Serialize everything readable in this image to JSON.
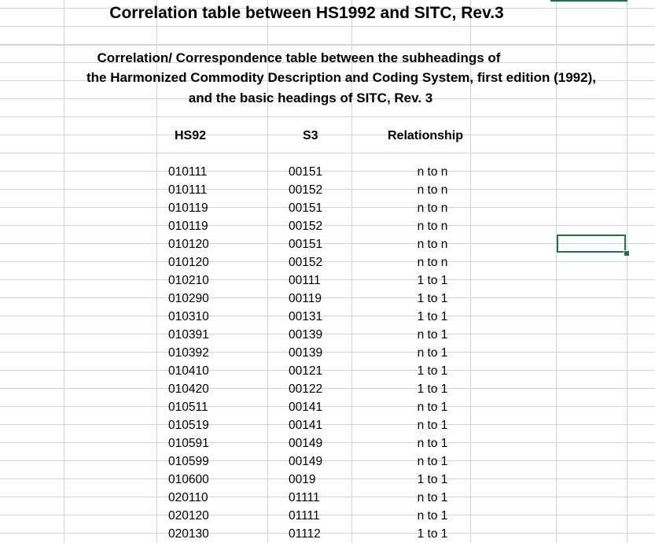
{
  "title": "Correlation table between HS1992 and SITC, Rev.3",
  "subtitle": {
    "line1": "Correlation/ Correspondence table between the subheadings of",
    "line2": "the Harmonized Commodity Description and Coding System, first edition (1992),",
    "line3": "and the basic headings of SITC, Rev. 3"
  },
  "headers": {
    "hs": "HS92",
    "s3": "S3",
    "rel": "Relationship"
  },
  "rows": [
    {
      "hs": "010111",
      "s3": "00151",
      "rel": "n to n"
    },
    {
      "hs": "010111",
      "s3": "00152",
      "rel": "n to n"
    },
    {
      "hs": "010119",
      "s3": "00151",
      "rel": "n to n"
    },
    {
      "hs": "010119",
      "s3": "00152",
      "rel": "n to n"
    },
    {
      "hs": "010120",
      "s3": "00151",
      "rel": "n to n"
    },
    {
      "hs": "010120",
      "s3": "00152",
      "rel": "n to n"
    },
    {
      "hs": "010210",
      "s3": "00111",
      "rel": "1 to 1"
    },
    {
      "hs": "010290",
      "s3": "00119",
      "rel": "1 to 1"
    },
    {
      "hs": "010310",
      "s3": "00131",
      "rel": "1 to 1"
    },
    {
      "hs": "010391",
      "s3": "00139",
      "rel": "n to 1"
    },
    {
      "hs": "010392",
      "s3": "00139",
      "rel": "n to 1"
    },
    {
      "hs": "010410",
      "s3": "00121",
      "rel": "1 to 1"
    },
    {
      "hs": "010420",
      "s3": "00122",
      "rel": "1 to 1"
    },
    {
      "hs": "010511",
      "s3": "00141",
      "rel": "n to 1"
    },
    {
      "hs": "010519",
      "s3": "00141",
      "rel": "n to 1"
    },
    {
      "hs": "010591",
      "s3": "00149",
      "rel": "n to 1"
    },
    {
      "hs": "010599",
      "s3": "00149",
      "rel": "n to 1"
    },
    {
      "hs": "010600",
      "s3": "0019",
      "rel": "1 to 1"
    },
    {
      "hs": "020110",
      "s3": "01111",
      "rel": "n to 1"
    },
    {
      "hs": "020120",
      "s3": "01111",
      "rel": "n to 1"
    },
    {
      "hs": "020130",
      "s3": "01112",
      "rel": "1 to 1"
    }
  ],
  "colors": {
    "gridline": "#d4d4d4",
    "selection": "#217346"
  }
}
